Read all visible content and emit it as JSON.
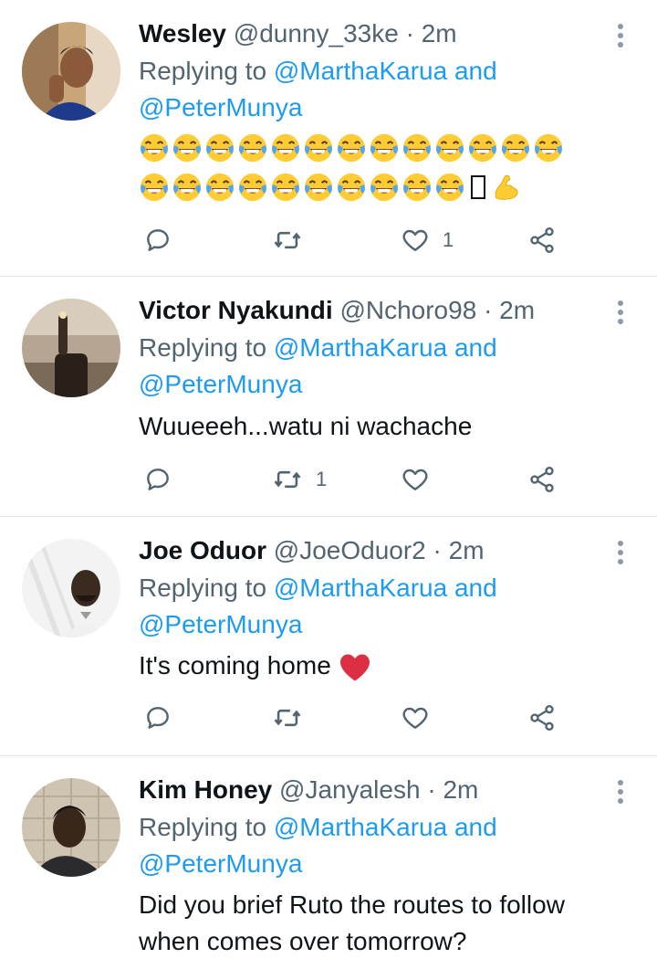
{
  "tweets": [
    {
      "name": "Wesley",
      "handle": "@dunny_33ke",
      "dot": "·",
      "time": "2m",
      "reply_prefix": "Replying to",
      "reply_user1": "@MarthaKarua",
      "reply_and": "and",
      "reply_user2": "@PeterMunya",
      "text": "",
      "emoji_line1": "😂😂😂😂😂😂😂😂😂😂😂😂😂",
      "emoji_line2": "😂😂😂😂😂😂😂😂😂😂💪",
      "counts": {
        "reply": "",
        "retweet": "",
        "like": "1"
      }
    },
    {
      "name": "Victor Nyakundi",
      "handle": "@Nchoro98",
      "dot": "·",
      "time": "2m",
      "reply_prefix": "Replying to",
      "reply_user1": "@MarthaKarua",
      "reply_and": "and",
      "reply_user2": "@PeterMunya",
      "text": "Wuueeeh...watu ni wachache",
      "counts": {
        "reply": "",
        "retweet": "1",
        "like": ""
      }
    },
    {
      "name": "Joe Oduor",
      "handle": "@JoeOduor2",
      "dot": "·",
      "time": "2m",
      "reply_prefix": "Replying to",
      "reply_user1": "@MarthaKarua",
      "reply_and": "and",
      "reply_user2": "@PeterMunya",
      "text": "It's coming home",
      "counts": {
        "reply": "",
        "retweet": "",
        "like": ""
      }
    },
    {
      "name": "Kim Honey",
      "handle": "@Janyalesh",
      "dot": "·",
      "time": "2m",
      "reply_prefix": "Replying to",
      "reply_user1": "@MarthaKarua",
      "reply_and": "and",
      "reply_user2": "@PeterMunya",
      "text_line1": "Did you brief Ruto the routes to follow",
      "text_line2": "when comes over tomorrow?"
    }
  ],
  "colors": {
    "link": "#1d9bf0",
    "muted": "#536471",
    "text": "#0f1419"
  },
  "icons": [
    "reply-icon",
    "retweet-icon",
    "like-icon",
    "share-icon",
    "more-icon",
    "laughing-emoji",
    "flexed-biceps-emoji",
    "red-heart-emoji"
  ]
}
